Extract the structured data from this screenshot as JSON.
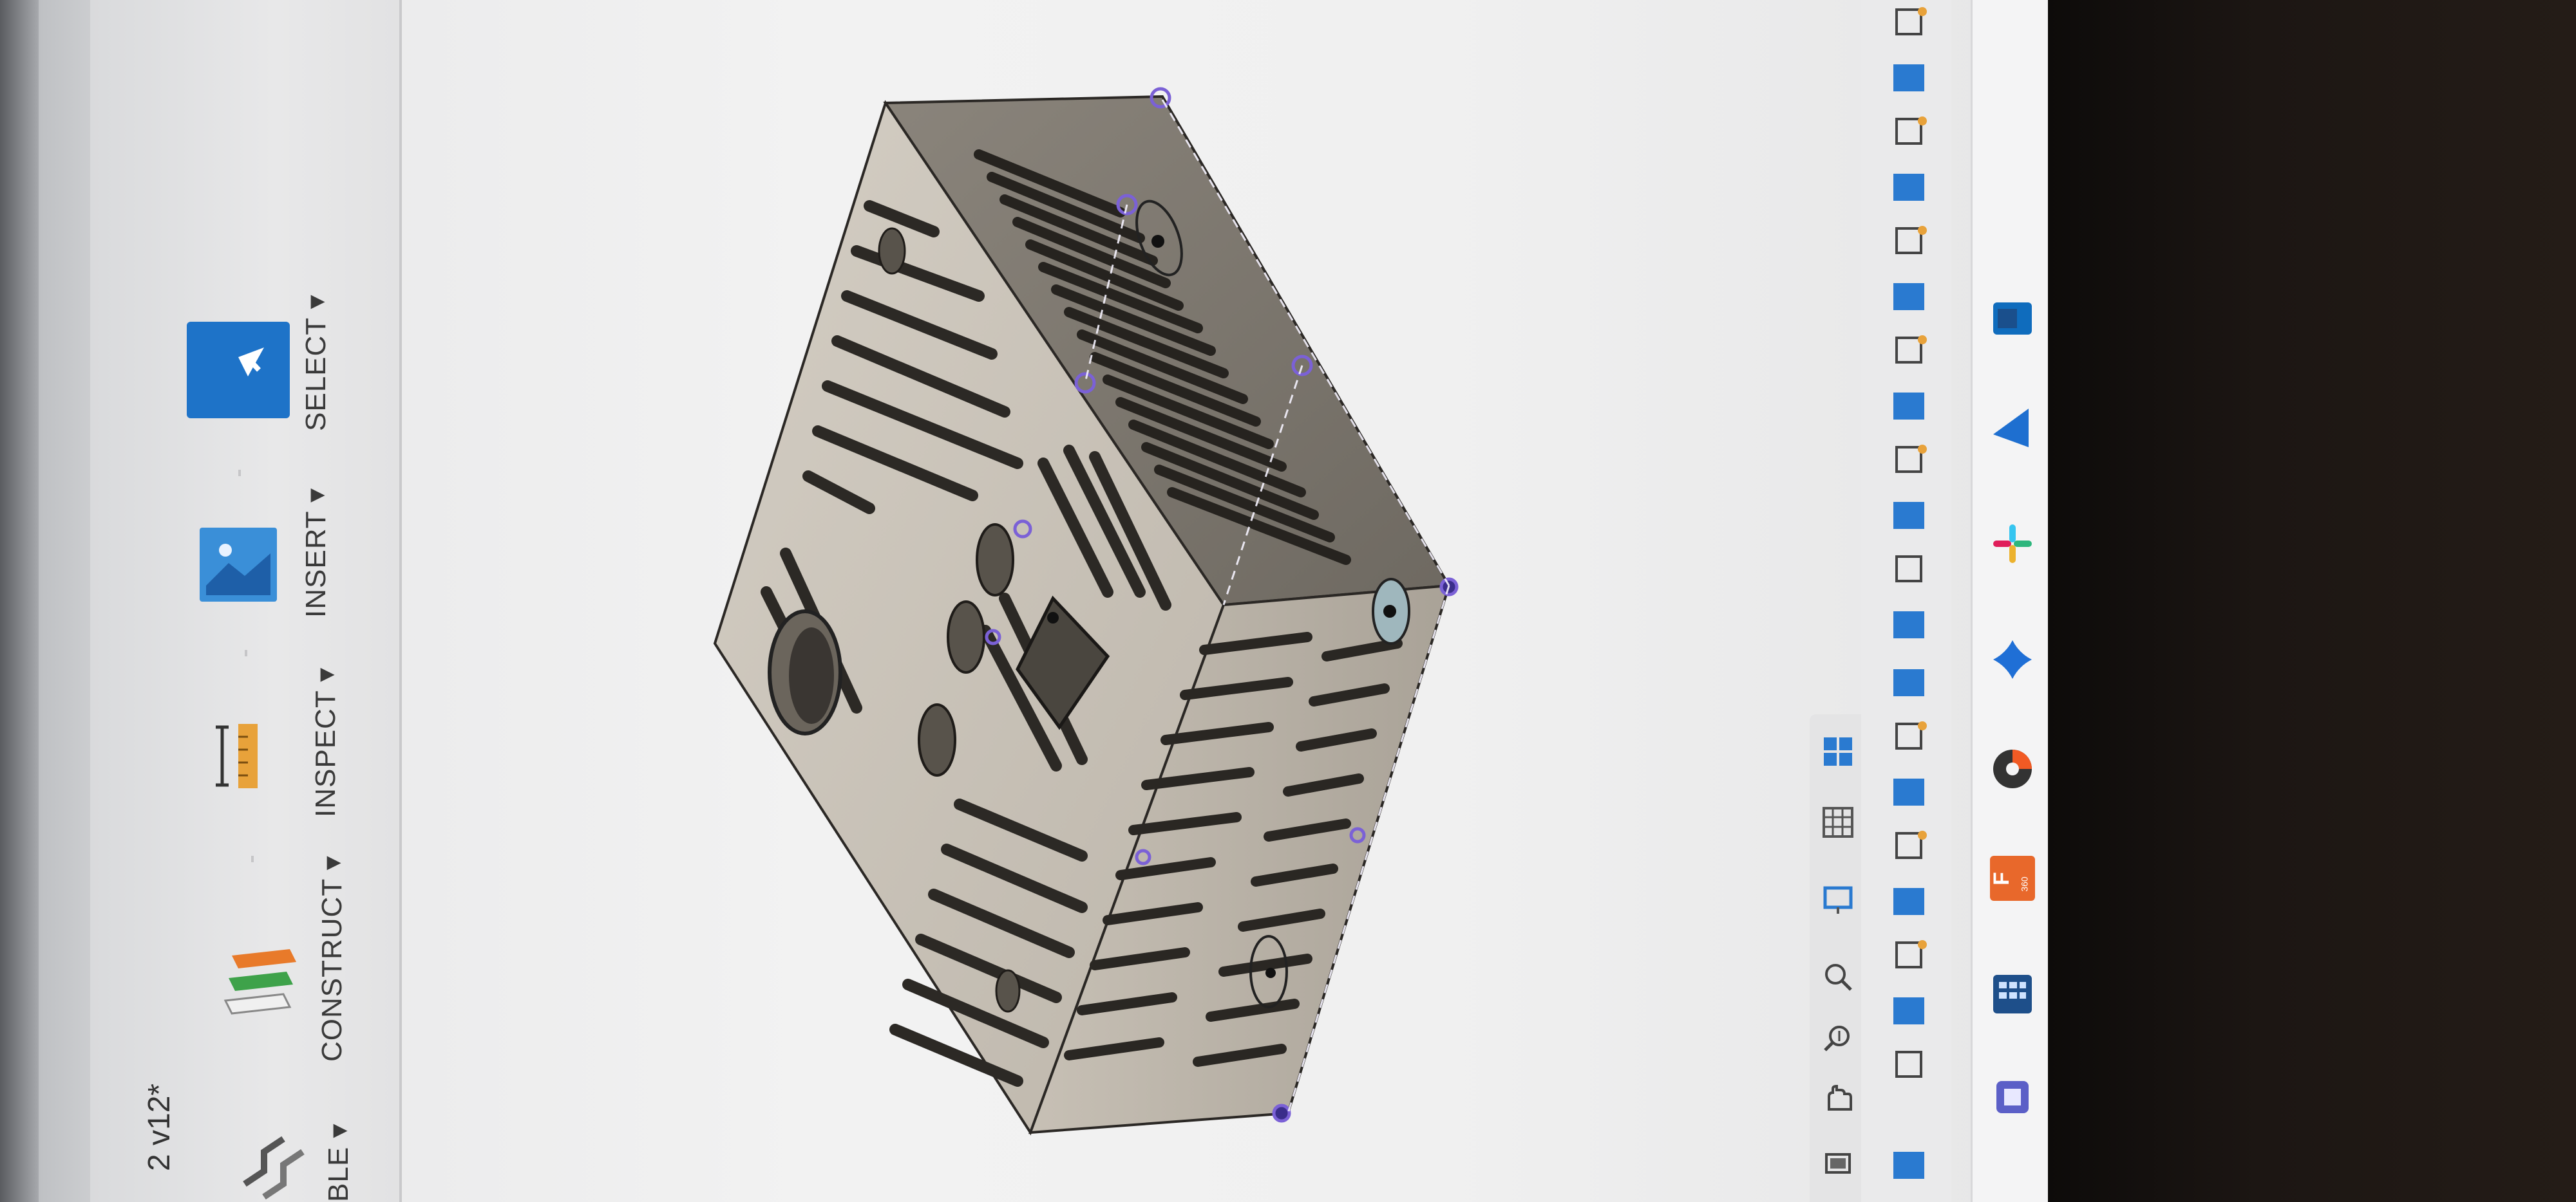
{
  "document": {
    "title_fragment": "2 v12*"
  },
  "toolbar": {
    "groups": [
      {
        "id": "select",
        "label": "SELECT ▾",
        "icon": "select-arrow-icon"
      },
      {
        "id": "insert",
        "label": "INSERT ▾",
        "icon": "insert-image-icon"
      },
      {
        "id": "inspect",
        "label": "INSPECT ▾",
        "icon": "measure-icon"
      },
      {
        "id": "construct",
        "label": "CONSTRUCT ▾",
        "icon": "construct-planes-icon"
      },
      {
        "id": "assemble",
        "label": "BLE ▾",
        "icon": "joint-icon"
      }
    ]
  },
  "nav_bar": {
    "items": [
      "orbit-icon",
      "pan-icon",
      "zoom-icon",
      "fit-icon",
      "display-settings-icon",
      "grid-icon",
      "viewports-icon"
    ]
  },
  "taskbar": {
    "apps": [
      "teams-icon",
      "table-app-icon",
      "fusion360-icon",
      "chrome-like-icon",
      "copilot-icon",
      "slack-icon",
      "arrow-app-icon",
      "outlook-icon"
    ],
    "fusion_badge": "F",
    "fusion_sub": "360"
  },
  "colors": {
    "accent_blue": "#1e73c8",
    "model_face": "#c9c2b7",
    "model_dark": "#3e3a36",
    "selection_purple": "#7b61d6"
  }
}
